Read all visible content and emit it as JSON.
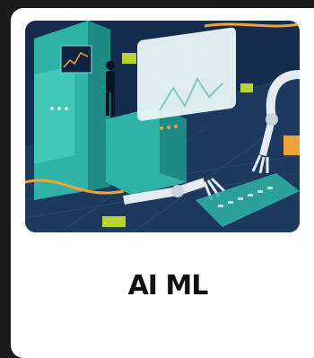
{
  "card": {
    "title": "AI ML",
    "image_icon": "ai-ml-illustration"
  },
  "colors": {
    "page_background": "#1b1b1b",
    "card_background": "#ffffff",
    "title_text": "#111111",
    "illustration_teal": "#2fb3a6",
    "illustration_navy": "#152a4a",
    "illustration_orange": "#f0a23a",
    "illustration_lime": "#b7d335"
  }
}
